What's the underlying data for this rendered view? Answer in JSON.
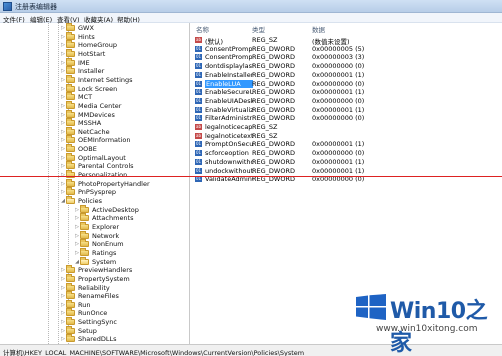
{
  "window": {
    "title": "注册表编辑器"
  },
  "menu": [
    "文件(F)",
    "编辑(E)",
    "查看(V)",
    "收藏夹(A)",
    "帮助(H)"
  ],
  "tree": [
    {
      "label": "GWX",
      "open": false
    },
    {
      "label": "Hints",
      "open": false
    },
    {
      "label": "HomeGroup",
      "open": false
    },
    {
      "label": "HotStart",
      "open": false
    },
    {
      "label": "IME",
      "open": false
    },
    {
      "label": "Installer",
      "open": false
    },
    {
      "label": "Internet Settings",
      "open": false
    },
    {
      "label": "Lock Screen",
      "open": false
    },
    {
      "label": "MCT",
      "open": false
    },
    {
      "label": "Media Center",
      "open": false
    },
    {
      "label": "MMDevices",
      "open": false
    },
    {
      "label": "MSSHA",
      "open": false
    },
    {
      "label": "NetCache",
      "open": false
    },
    {
      "label": "OEMInformation",
      "open": false
    },
    {
      "label": "OOBE",
      "open": false
    },
    {
      "label": "OptimalLayout",
      "open": false
    },
    {
      "label": "Parental Controls",
      "open": false
    },
    {
      "label": "Personalization",
      "open": false
    },
    {
      "label": "PhotoPropertyHandler",
      "open": false
    },
    {
      "label": "PnPSysprep",
      "open": false
    },
    {
      "label": "Policies",
      "open": true
    },
    {
      "label": "ActiveDesktop",
      "open": false,
      "child": true
    },
    {
      "label": "Attachments",
      "open": false,
      "child": true
    },
    {
      "label": "Explorer",
      "open": false,
      "child": true
    },
    {
      "label": "Network",
      "open": false,
      "child": true
    },
    {
      "label": "NonEnum",
      "open": false,
      "child": true
    },
    {
      "label": "Ratings",
      "open": false,
      "child": true
    },
    {
      "label": "System",
      "open": true,
      "child": true
    },
    {
      "label": "PreviewHandlers",
      "open": false
    },
    {
      "label": "PropertySystem",
      "open": false
    },
    {
      "label": "Reliability",
      "open": false
    },
    {
      "label": "RenameFiles",
      "open": false
    },
    {
      "label": "Run",
      "open": false
    },
    {
      "label": "RunOnce",
      "open": false
    },
    {
      "label": "SettingSync",
      "open": false
    },
    {
      "label": "Setup",
      "open": false
    },
    {
      "label": "SharedDLLs",
      "open": false
    }
  ],
  "list": {
    "headers": {
      "name": "名称",
      "type": "类型",
      "data": "数据"
    },
    "rows": [
      {
        "icon": "sz",
        "name": "(默认)",
        "type": "REG_SZ",
        "data": "(数值未设置)"
      },
      {
        "icon": "dw",
        "name": "ConsentPrompt...",
        "type": "REG_DWORD",
        "data": "0x00000005 (5)"
      },
      {
        "icon": "dw",
        "name": "ConsentPrompt...",
        "type": "REG_DWORD",
        "data": "0x00000003 (3)"
      },
      {
        "icon": "dw",
        "name": "dontdisplaylastu...",
        "type": "REG_DWORD",
        "data": "0x00000000 (0)"
      },
      {
        "icon": "dw",
        "name": "EnableInstallerD...",
        "type": "REG_DWORD",
        "data": "0x00000001 (1)"
      },
      {
        "icon": "dw",
        "name": "EnableLUA",
        "type": "REG_DWORD",
        "data": "0x00000000 (0)",
        "selected": true
      },
      {
        "icon": "dw",
        "name": "EnableSecureUIA...",
        "type": "REG_DWORD",
        "data": "0x00000001 (1)"
      },
      {
        "icon": "dw",
        "name": "EnableUIADeskt...",
        "type": "REG_DWORD",
        "data": "0x00000000 (0)"
      },
      {
        "icon": "dw",
        "name": "EnableVirtualiz...",
        "type": "REG_DWORD",
        "data": "0x00000001 (1)"
      },
      {
        "icon": "dw",
        "name": "FilterAdministra...",
        "type": "REG_DWORD",
        "data": "0x00000000 (0)"
      },
      {
        "icon": "sz",
        "name": "legalnoticecapti...",
        "type": "REG_SZ",
        "data": ""
      },
      {
        "icon": "sz",
        "name": "legalnoticetext",
        "type": "REG_SZ",
        "data": ""
      },
      {
        "icon": "dw",
        "name": "PromptOnSecur...",
        "type": "REG_DWORD",
        "data": "0x00000001 (1)"
      },
      {
        "icon": "dw",
        "name": "scforceoption",
        "type": "REG_DWORD",
        "data": "0x00000000 (0)"
      },
      {
        "icon": "dw",
        "name": "shutdownwitho...",
        "type": "REG_DWORD",
        "data": "0x00000001 (1)"
      },
      {
        "icon": "dw",
        "name": "undockwithoutl...",
        "type": "REG_DWORD",
        "data": "0x00000001 (1)"
      },
      {
        "icon": "dw",
        "name": "ValidateAdminC...",
        "type": "REG_DWORD",
        "data": "0x00000000 (0)"
      }
    ]
  },
  "status": {
    "path": "计算机\\HKEY_LOCAL_MACHINE\\SOFTWARE\\Microsoft\\Windows\\CurrentVersion\\Policies\\System"
  },
  "watermark": {
    "title": "Win10之家",
    "url": "www.win10xitong.com"
  },
  "colors": {
    "selection": "#3399ff",
    "red_line": "#dd2222",
    "brand": "#1f5aa8"
  }
}
